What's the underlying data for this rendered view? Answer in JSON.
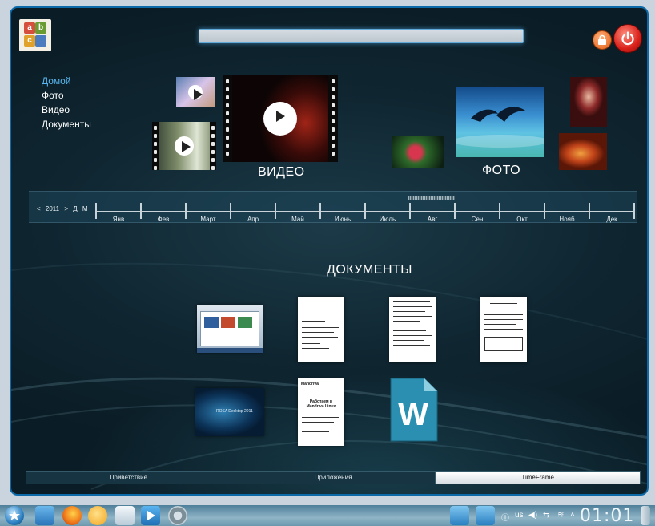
{
  "search": {
    "value": ""
  },
  "nav": {
    "items": [
      {
        "label": "Домой",
        "active": true
      },
      {
        "label": "Фото",
        "active": false
      },
      {
        "label": "Видео",
        "active": false
      },
      {
        "label": "Документы",
        "active": false
      }
    ]
  },
  "sections": {
    "video": "ВИДЕО",
    "photo": "ФОТО",
    "documents": "ДОКУМЕНТЫ"
  },
  "timeline": {
    "prev": "<",
    "year": "2011",
    "next": ">",
    "day": "Д",
    "month": "М",
    "months": [
      "Янв",
      "Фев",
      "Март",
      "Апр",
      "Май",
      "Июнь",
      "Июль",
      "Авг",
      "Сен",
      "Окт",
      "Нояб",
      "Дек"
    ],
    "selected_month": "Авг"
  },
  "documents": [
    {
      "name": "screenshot-document",
      "kind": "screenshot"
    },
    {
      "name": "text-document-1",
      "kind": "text"
    },
    {
      "name": "text-document-2",
      "kind": "text"
    },
    {
      "name": "form-document",
      "kind": "form"
    },
    {
      "name": "rosa-desktop-document",
      "kind": "image",
      "caption": "ROSA Desktop 2011"
    },
    {
      "name": "mandriva-document",
      "kind": "text",
      "brand": "Mandriva",
      "heading": "Работаем в Mandriva Linux"
    },
    {
      "name": "word-document",
      "kind": "word",
      "letter": "W"
    }
  ],
  "tabs": [
    {
      "label": "Приветствие",
      "active": false
    },
    {
      "label": "Приложения",
      "active": false
    },
    {
      "label": "TimeFrame",
      "active": true
    }
  ],
  "taskbar": {
    "icons": [
      "rosa-start-icon",
      "file-manager-icon",
      "firefox-icon",
      "chat-icon",
      "mail-icon",
      "media-player-icon",
      "settings-icon"
    ],
    "layout": "us",
    "clock": "01:01"
  },
  "colors": {
    "accent": "#5ab6ee",
    "frame": "#0d6aa8",
    "power": "#d9201a",
    "lock": "#e35d12"
  }
}
